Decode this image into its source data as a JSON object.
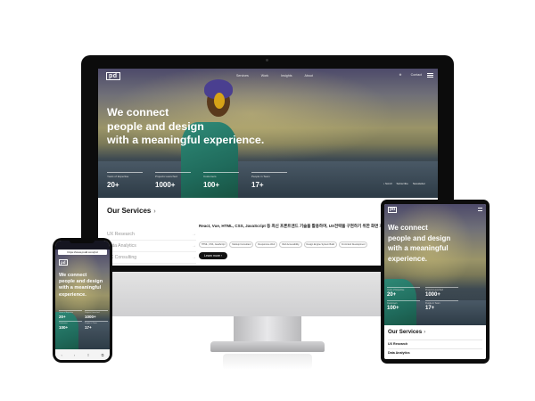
{
  "site": {
    "logo": "pd",
    "nav": [
      "Services",
      "Work",
      "Insights",
      "About"
    ],
    "right_links": [
      "⊕",
      "Contact"
    ],
    "headline": [
      "We connect",
      "people and design",
      "with a meaningful experience."
    ],
    "stats": [
      {
        "label": "Years of Expertise",
        "value": "20+"
      },
      {
        "label": "Projects Launched",
        "value": "1000+"
      },
      {
        "label": "Customers",
        "value": "100+"
      },
      {
        "label": "People in Team",
        "value": "17+"
      }
    ],
    "mini_links": [
      "• Scroll",
      "Subscribe",
      "Newsletter"
    ],
    "services_title": "Our Services",
    "services_chevron": "›",
    "services": [
      "UX Research",
      "Data Analytics",
      "UX Consulting"
    ],
    "services_arrow": "→",
    "service_description": "React, Vue, HTML, CSS, JavaScript 등 최신 프론트엔드 기술을 활용하여, UX전략을 구현하기 위한 화면 개발을 수행합니다.",
    "service_chips": [
      "HTML, CSS, JavaScript",
      "Markup Consultant",
      "Responsive Web",
      "Web Accessibility",
      "Design Engine System Build",
      "Front End Development"
    ],
    "more_button": "Learn more ›"
  },
  "phone": {
    "url": "https://www.pxdd.com/pid",
    "bottom_icons": [
      "‹",
      "›",
      "⇧",
      "⧉"
    ]
  },
  "tablet": {
    "services": [
      "UX Research",
      "Data Analytics"
    ]
  }
}
